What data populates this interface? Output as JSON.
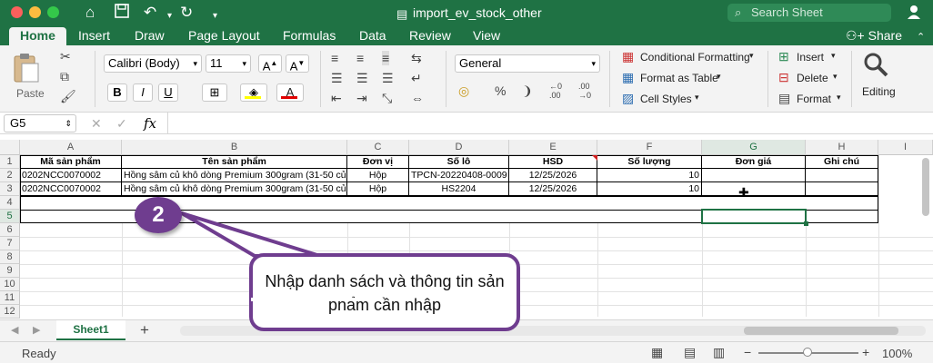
{
  "app": {
    "doc_title": "import_ev_stock_other",
    "search_placeholder": "Search Sheet",
    "share_label": "Share"
  },
  "tabs": [
    "Home",
    "Insert",
    "Draw",
    "Page Layout",
    "Formulas",
    "Data",
    "Review",
    "View"
  ],
  "ribbon": {
    "paste_label": "Paste",
    "font_name": "Calibri (Body)",
    "font_size": "11",
    "number_format": "General",
    "conditional_formatting": "Conditional Formatting",
    "format_as_table": "Format as Table",
    "cell_styles": "Cell Styles",
    "insert": "Insert",
    "delete": "Delete",
    "format": "Format",
    "editing": "Editing"
  },
  "formula_bar": {
    "name_box": "G5",
    "fx": "fx",
    "value": ""
  },
  "grid": {
    "columns": [
      "A",
      "B",
      "C",
      "D",
      "E",
      "F",
      "G",
      "H",
      "I"
    ],
    "rows": [
      "1",
      "2",
      "3",
      "4",
      "5",
      "6",
      "7",
      "8",
      "9",
      "10",
      "11",
      "12"
    ],
    "header": [
      "Mã sản phẩm",
      "Tên sản phẩm",
      "Đơn vị",
      "Số lô",
      "HSD",
      "Số lượng",
      "Đơn giá",
      "Ghi chú"
    ],
    "data": [
      [
        "0202NCC0070002",
        "Hồng sâm củ khô dòng Premium 300gram (31-50 củ)",
        "Hộp",
        "TPCN-20220408-0009",
        "12/25/2026",
        "10",
        "",
        ""
      ],
      [
        "0202NCC0070002",
        "Hồng sâm củ khô dòng Premium 300gram (31-50 củ)",
        "Hộp",
        "HS2204",
        "12/25/2026",
        "10",
        "",
        ""
      ]
    ],
    "selected_cell": "G5"
  },
  "sheets": [
    "Sheet1"
  ],
  "status": {
    "ready": "Ready",
    "zoom": "100%"
  },
  "callout": {
    "badge": "2",
    "text": "Nhập danh sách và thông tin sản phẩm cần nhập"
  },
  "colors": {
    "excel_green": "#1f7244",
    "callout_purple": "#6f3d8f"
  }
}
